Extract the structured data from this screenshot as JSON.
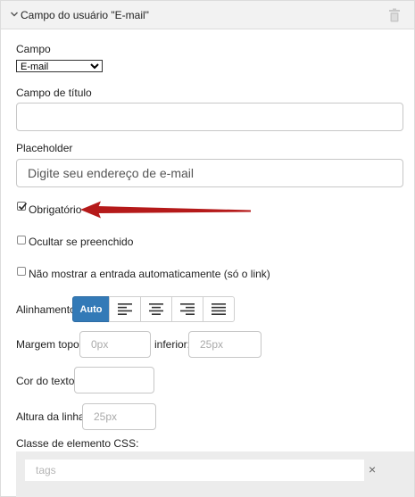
{
  "header": {
    "title": "Campo do usuário \"E-mail\"",
    "chevron_icon": "chevron-down-icon",
    "delete_icon": "trash-icon"
  },
  "field": {
    "label": "Campo",
    "selected": "E-mail"
  },
  "title_field": {
    "label": "Campo de título",
    "value": ""
  },
  "placeholder_field": {
    "label": "Placeholder",
    "value": "Digite seu endereço de e-mail"
  },
  "required": {
    "label": "Obrigatório",
    "checked": true
  },
  "hide_filled": {
    "label": "Ocultar se preenchido",
    "checked": false
  },
  "no_autofill": {
    "label": "Não mostrar a entrada automaticamente (só o link)",
    "checked": false
  },
  "alignment": {
    "label": "Alinhamento",
    "auto_label": "Auto",
    "options": [
      "align-left-icon",
      "align-center-icon",
      "align-right-icon",
      "align-justify-icon"
    ],
    "active_color": "#337ab7"
  },
  "margin": {
    "top_label": "Margem topo:",
    "top_placeholder": "0px",
    "bottom_label": "inferior:",
    "bottom_placeholder": "25px"
  },
  "text_color": {
    "label": "Cor do texto:",
    "value": ""
  },
  "line_height": {
    "label": "Altura da linha:",
    "placeholder": "25px"
  },
  "css_class": {
    "label": "Classe de elemento CSS:",
    "placeholder": "tags",
    "clear_symbol": "×"
  },
  "annotation": {
    "arrow_color": "#b51a1a"
  }
}
